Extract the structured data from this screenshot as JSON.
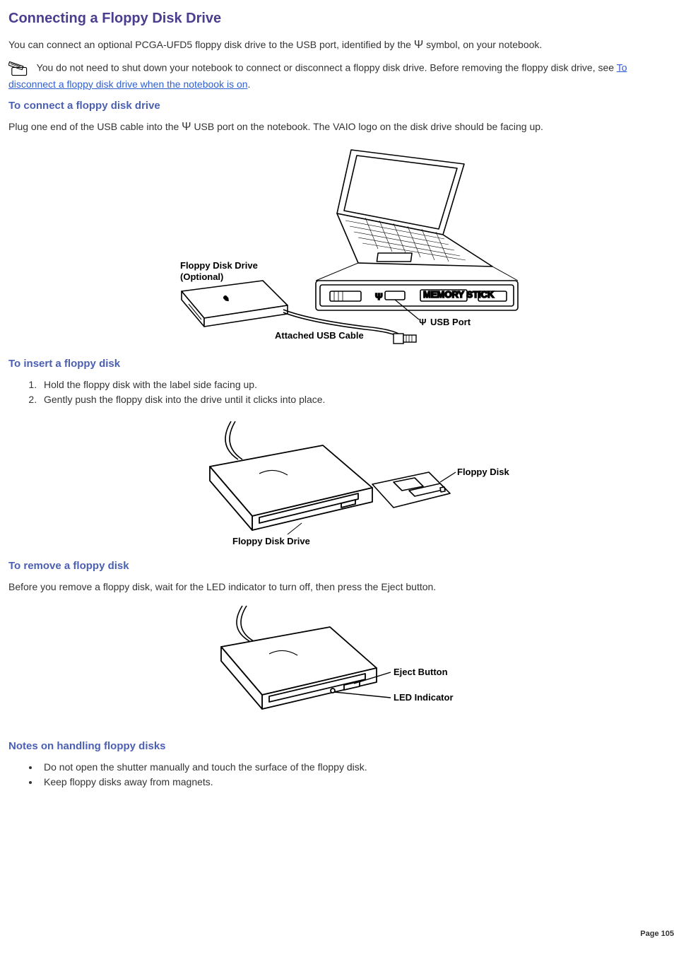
{
  "h1": "Connecting a Floppy Disk Drive",
  "intro_pre": "You can connect an optional PCGA-UFD5 floppy disk drive to the USB port, identified by the ",
  "intro_post": "symbol, on your notebook.",
  "note_text_pre": "You do not need to shut down your notebook to connect or disconnect a floppy disk drive. Before removing the floppy disk drive, see ",
  "note_link": "To disconnect a floppy disk drive when the notebook is on",
  "note_text_post": ".",
  "h2_connect": "To connect a floppy disk drive",
  "connect_text_pre": "Plug one end of the USB cable into the ",
  "connect_text_post": "USB port on the notebook. The VAIO logo on the disk drive should be facing up.",
  "fig1": {
    "label_drive_l1": "Floppy Disk Drive",
    "label_drive_l2": "(Optional)",
    "label_cable": "Attached USB Cable",
    "label_usb_port": "USB Port",
    "label_mem_stick": "MEMORY STICK"
  },
  "h2_insert": "To insert a floppy disk",
  "insert_steps": [
    "Hold the floppy disk with the label side facing up.",
    "Gently push the floppy disk into the drive until it clicks into place."
  ],
  "fig2": {
    "label_drive": "Floppy Disk Drive",
    "label_disk": "Floppy Disk"
  },
  "h2_remove": "To remove a floppy disk",
  "remove_text": "Before you remove a floppy disk, wait for the LED indicator to turn off, then press the Eject button.",
  "fig3": {
    "label_eject": "Eject Button",
    "label_led": "LED Indicator"
  },
  "h2_notes": "Notes on handling floppy disks",
  "notes_items": [
    "Do not open the shutter manually and touch the surface of the floppy disk.",
    "Keep floppy disks away from magnets."
  ],
  "page_number": "Page 105"
}
